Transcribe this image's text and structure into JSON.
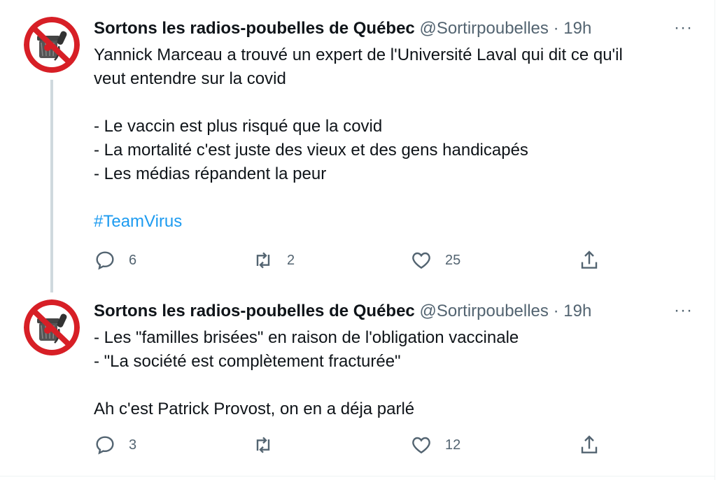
{
  "tweets": [
    {
      "author": {
        "name": "Sortons les radios-poubelles de Québec",
        "handle": "@Sortirpoubelles",
        "avatar_icon": "no-trash-radio-avatar-icon"
      },
      "separator": "·",
      "time": "19h",
      "more": "···",
      "lines": [
        "Yannick Marceau a trouvé un expert de l'Université Laval qui dit ce qu'il",
        "veut entendre sur la covid",
        "",
        "- Le vaccin est plus risqué que la covid",
        "- La mortalité c'est juste des vieux et des gens handicapés",
        "- Les médias répandent la peur",
        ""
      ],
      "hashtag": "#TeamVirus",
      "replies": "6",
      "retweets": "2",
      "likes": "25"
    },
    {
      "author": {
        "name": "Sortons les radios-poubelles de Québec",
        "handle": "@Sortirpoubelles",
        "avatar_icon": "no-trash-radio-avatar-icon"
      },
      "separator": "·",
      "time": "19h",
      "more": "···",
      "lines": [
        "- Les \"familles brisées\" en raison de l'obligation vaccinale",
        "- \"La société est complètement fracturée\"",
        "",
        "Ah c'est Patrick Provost, on en a déja parlé"
      ],
      "replies": "3",
      "retweets": "",
      "likes": "12"
    }
  ],
  "colors": {
    "accent": "#1d9bf0",
    "text": "#0f1419",
    "muted": "#536471",
    "avatar_red": "#d71f26"
  }
}
